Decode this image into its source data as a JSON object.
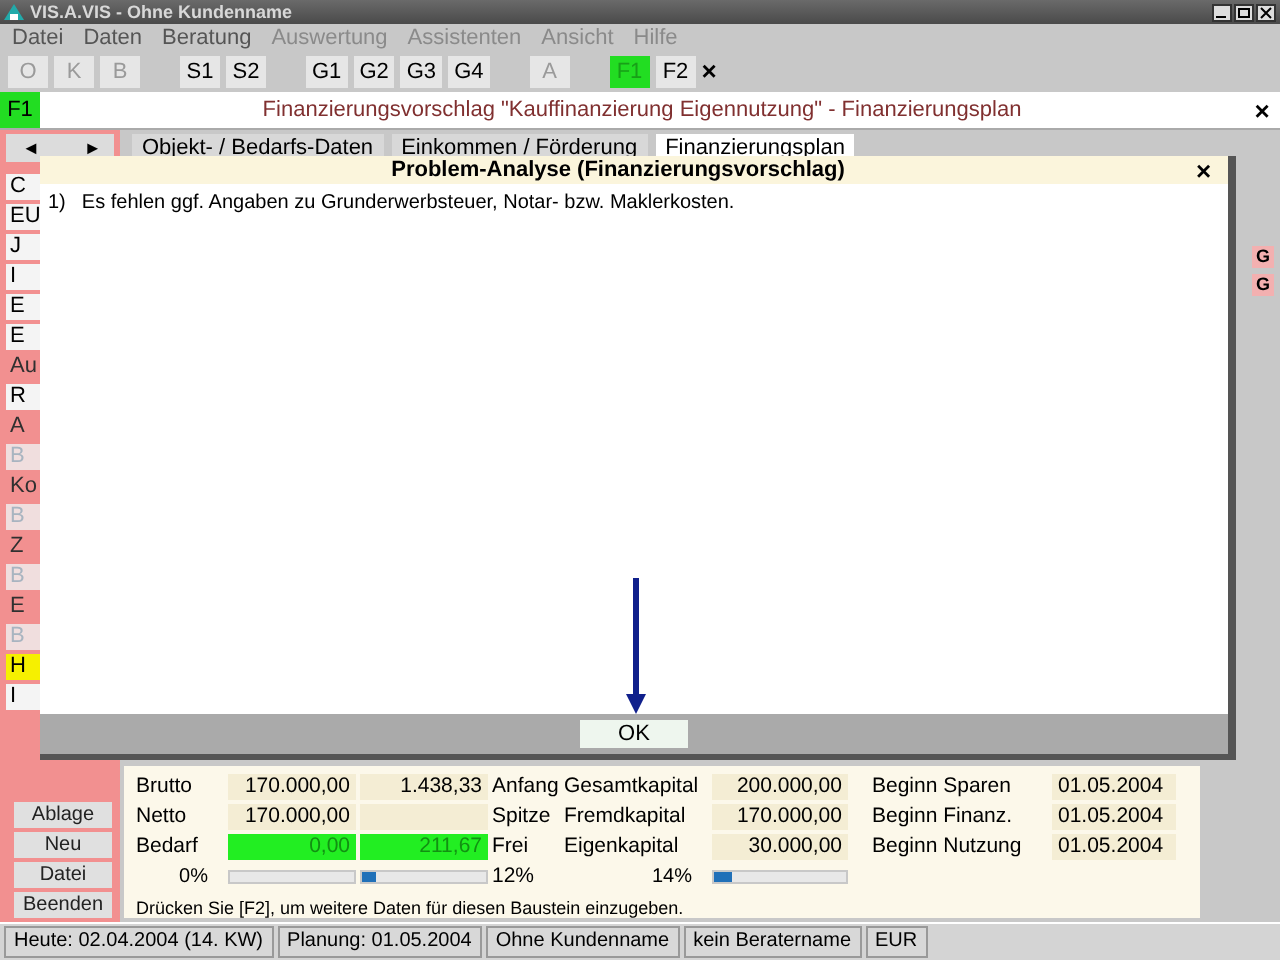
{
  "window": {
    "title": "VIS.A.VIS - Ohne Kundenname"
  },
  "menu": [
    {
      "label": "Datei",
      "disabled": false
    },
    {
      "label": "Daten",
      "disabled": false
    },
    {
      "label": "Beratung",
      "disabled": false
    },
    {
      "label": "Auswertung",
      "disabled": true
    },
    {
      "label": "Assistenten",
      "disabled": true
    },
    {
      "label": "Ansicht",
      "disabled": true
    },
    {
      "label": "Hilfe",
      "disabled": true
    }
  ],
  "toolbar_groups": [
    {
      "buttons": [
        {
          "label": "O",
          "disabled": true,
          "selected": false
        },
        {
          "label": "K",
          "disabled": true,
          "selected": false
        },
        {
          "label": "B",
          "disabled": true,
          "selected": false
        }
      ]
    },
    {
      "buttons": [
        {
          "label": "S1",
          "disabled": false,
          "selected": false
        },
        {
          "label": "S2",
          "disabled": false,
          "selected": false
        }
      ]
    },
    {
      "buttons": [
        {
          "label": "G1",
          "disabled": false,
          "selected": false
        },
        {
          "label": "G2",
          "disabled": false,
          "selected": false
        },
        {
          "label": "G3",
          "disabled": false,
          "selected": false
        },
        {
          "label": "G4",
          "disabled": false,
          "selected": false
        }
      ]
    },
    {
      "buttons": [
        {
          "label": "A",
          "disabled": true,
          "selected": false
        }
      ]
    },
    {
      "buttons": [
        {
          "label": "F1",
          "disabled": true,
          "selected": true
        },
        {
          "label": "F2",
          "disabled": false,
          "selected": false
        }
      ],
      "close": "×"
    }
  ],
  "header": {
    "badge": "F1",
    "title": "Finanzierungsvorschlag \"Kauffinanzierung Eigennutzung\" - Finanzierungsplan",
    "close": "×"
  },
  "tab_nav": [
    "◄",
    "►"
  ],
  "tabs": [
    {
      "label": "Objekt- / Bedarfs-Daten",
      "selected": false
    },
    {
      "label": "Einkommen / Förderung",
      "selected": false
    },
    {
      "label": "Finanzierungsplan",
      "selected": true
    }
  ],
  "sidebar": {
    "items": [
      {
        "kind": "box",
        "label": "C",
        "disabled": false,
        "selected": false
      },
      {
        "kind": "box",
        "label": "EU",
        "disabled": false,
        "selected": false
      },
      {
        "kind": "box",
        "label": "J",
        "disabled": false,
        "selected": false
      },
      {
        "kind": "box",
        "label": "I",
        "disabled": false,
        "selected": false
      },
      {
        "kind": "box",
        "label": "E",
        "disabled": false,
        "selected": false
      },
      {
        "kind": "box",
        "label": "E",
        "disabled": false,
        "selected": false
      },
      {
        "kind": "heading",
        "label": "Au"
      },
      {
        "kind": "box",
        "label": "R",
        "disabled": false,
        "selected": false
      },
      {
        "kind": "heading",
        "label": "A"
      },
      {
        "kind": "box",
        "label": "B",
        "disabled": true,
        "selected": false
      },
      {
        "kind": "heading",
        "label": "Ko"
      },
      {
        "kind": "box",
        "label": "B",
        "disabled": true,
        "selected": false
      },
      {
        "kind": "heading",
        "label": "Z"
      },
      {
        "kind": "box",
        "label": "B",
        "disabled": true,
        "selected": false
      },
      {
        "kind": "heading",
        "label": "E"
      },
      {
        "kind": "box",
        "label": "B",
        "disabled": true,
        "selected": false
      },
      {
        "kind": "box",
        "label": "H",
        "disabled": false,
        "selected": true
      },
      {
        "kind": "box",
        "label": "I",
        "disabled": false,
        "selected": false
      }
    ],
    "buttons": [
      "Ablage",
      "Neu",
      "Datei",
      "Beenden"
    ]
  },
  "side_badges": [
    "G",
    "G"
  ],
  "dialog": {
    "title": "Problem-Analyse (Finanzierungsvorschlag)",
    "close": "×",
    "messages": [
      {
        "number": "1)",
        "text": "Es fehlen ggf. Angaben zu Grunderwerbsteuer, Notar- bzw. Maklerkosten."
      }
    ],
    "button": "OK"
  },
  "summary": {
    "rows": [
      {
        "label": "Brutto",
        "value_1": "170.000,00",
        "value_2": "1.438,33",
        "label_2": "Anfang",
        "label_3": "Gesamtkapital",
        "value_3": "200.000,00",
        "label_4": "Beginn Sparen",
        "date": "01.05.2004",
        "highlight": false
      },
      {
        "label": "Netto",
        "value_1": "170.000,00",
        "label_2": "Spitze",
        "label_3": "Fremdkapital",
        "value_3": "170.000,00",
        "label_4": "Beginn Finanz.",
        "date": "01.05.2004",
        "highlight": false
      },
      {
        "label": "Bedarf",
        "value_1": "0,00",
        "value_2": "211,67",
        "label_2": "Frei",
        "label_3": "Eigenkapital",
        "value_3": "30.000,00",
        "label_4": "Beginn Nutzung",
        "date": "01.05.2004",
        "highlight": true
      }
    ],
    "meters": {
      "label_1": "0%",
      "bar_1": {
        "level": 0
      },
      "bar_2": {
        "level": 0.12
      },
      "label_2": "12%",
      "label_3": "14%",
      "bar_3": {
        "level": 0.14
      }
    },
    "hint": "Drücken Sie [F2], um weitere Daten für diesen Baustein einzugeben."
  },
  "status_bar": [
    "Heute: 02.04.2004 (14. KW)",
    "Planung: 01.05.2004",
    "Ohne Kundenname",
    "kein Beratername",
    "EUR"
  ]
}
